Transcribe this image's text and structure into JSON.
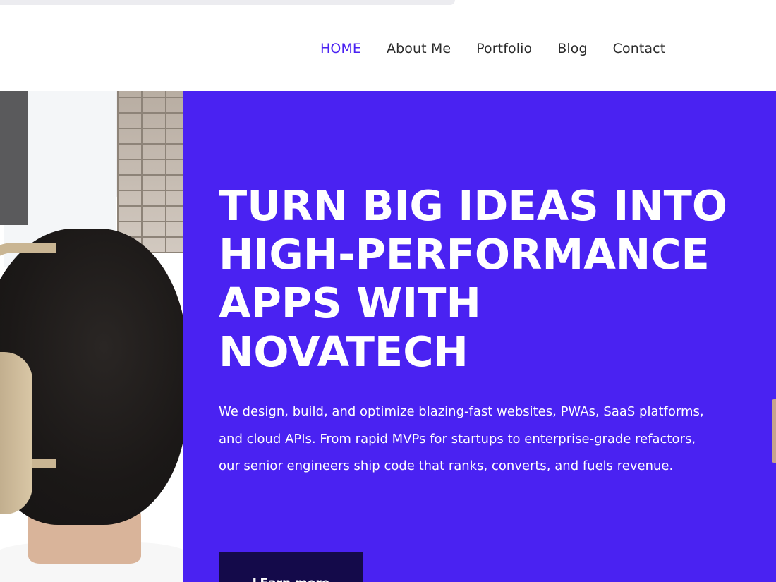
{
  "nav": {
    "items": [
      {
        "label": "HOME",
        "active": true
      },
      {
        "label": "About Me",
        "active": false
      },
      {
        "label": "Portfolio",
        "active": false
      },
      {
        "label": "Blog",
        "active": false
      },
      {
        "label": "Contact",
        "active": false
      }
    ]
  },
  "hero": {
    "title_lines": [
      "TURN BIG IDEAS INTO",
      "HIGH-PERFORMANCE",
      "APPS WITH",
      "NOVATECH"
    ],
    "body": "We design, build, and optimize blazing-fast websites, PWAs, SaaS platforms, and cloud APIs. From rapid MVPs for startups to enterprise-grade refactors, our senior engineers ship code that ranks, converts, and fuels revenue.",
    "cta_label": "LEarn more"
  },
  "colors": {
    "accent": "#4a22f2",
    "cta_bg": "#140a4a",
    "nav_text": "#2a2a2a",
    "nav_active": "#4a22f2"
  },
  "images": {
    "hero_photo": "person-with-headphones-photo"
  }
}
